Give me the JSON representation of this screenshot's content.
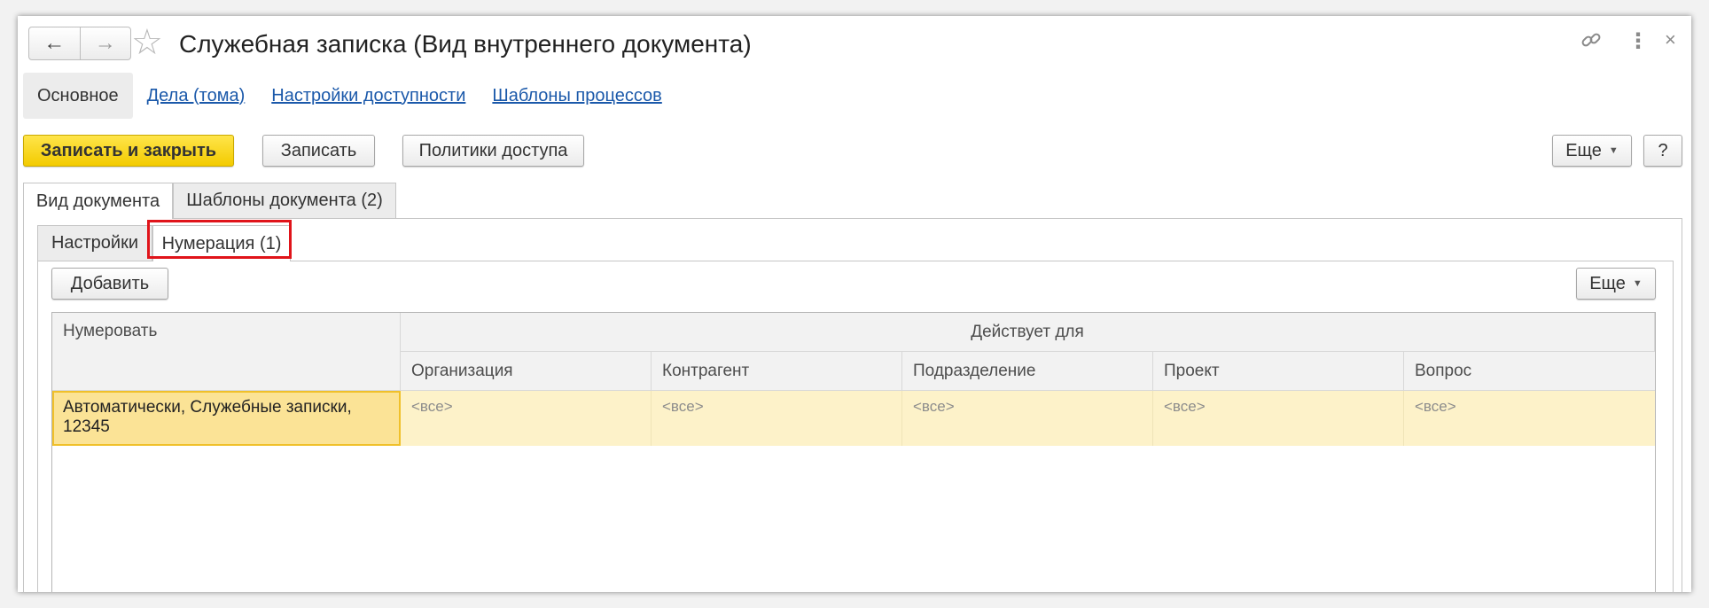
{
  "window": {
    "title": "Служебная записка (Вид внутреннего документа)",
    "back_icon": "←",
    "forward_icon": "→",
    "favorite_icon": "☆",
    "link_icon": "🔗",
    "more_icon": "⋮",
    "close_icon": "×"
  },
  "sections": {
    "active": "Основное",
    "links": [
      "Дела (тома)",
      "Настройки доступности",
      "Шаблоны процессов"
    ]
  },
  "toolbar": {
    "save_close": "Записать и закрыть",
    "save": "Записать",
    "access_policies": "Политики доступа",
    "more": "Еще",
    "help": "?"
  },
  "tabs": {
    "main": [
      "Вид документа",
      "Шаблоны документа (2)"
    ],
    "sub": [
      "Настройки",
      "Нумерация (1)"
    ]
  },
  "numbering": {
    "add": "Добавить",
    "more": "Еще",
    "columns": {
      "numerate": "Нумеровать",
      "applies_for": "Действует для",
      "sub": [
        "Организация",
        "Контрагент",
        "Подразделение",
        "Проект",
        "Вопрос"
      ]
    },
    "rows": [
      {
        "numerate": "Автоматически, Служебные записки, 12345",
        "values": [
          "<все>",
          "<все>",
          "<все>",
          "<все>",
          "<все>"
        ]
      }
    ]
  },
  "colors": {
    "primary_button": "#f3cb00",
    "link": "#1b59aa",
    "highlight": "#e0141a",
    "selected_row": "#fdf2c9"
  }
}
